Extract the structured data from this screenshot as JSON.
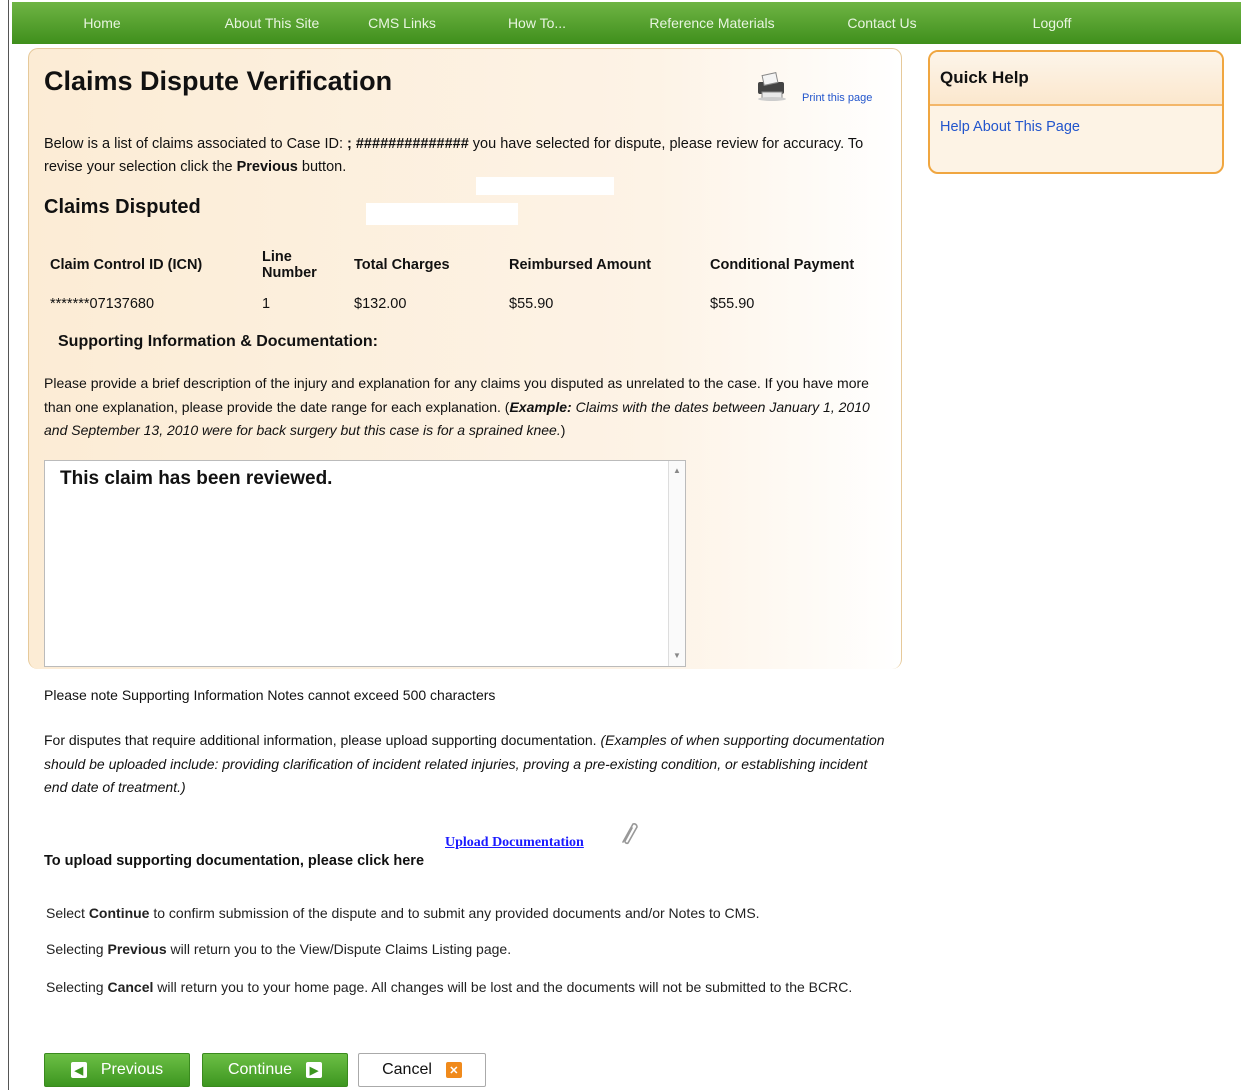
{
  "nav": [
    "Home",
    "About This Site",
    "CMS Links",
    "How To...",
    "Reference Materials",
    "Contact Us",
    "Logoff"
  ],
  "page": {
    "title": "Claims Dispute Verification",
    "print_label": "Print this page",
    "intro_before": "Below is a list of claims associated to Case ID: ",
    "case_id": "; ##############",
    "intro_after": "  you have selected for dispute, please review for accuracy. To revise your selection click the ",
    "intro_bold": "Previous",
    "intro_end": " button."
  },
  "claims": {
    "heading": "Claims Disputed",
    "columns": [
      "Claim Control ID (ICN)",
      "Line Number",
      "Total Charges",
      "Reimbursed Amount",
      "Conditional Payment"
    ],
    "rows": [
      [
        "*******07137680",
        "1",
        "$132.00",
        "$55.90",
        "$55.90"
      ]
    ]
  },
  "supporting": {
    "heading": "Supporting Information & Documentation:",
    "p1": "Please provide a brief description of the injury and explanation for any claims you disputed as unrelated to the case. If you have more than one explanation, please provide the date range for each explanation. (",
    "p1_example_label": "Example:",
    "p1_example": " Claims with the dates between January 1, 2010 and September 13, 2010 were for back surgery but this case is for a sprained knee.",
    "p1_end": ")",
    "textarea_value": "This claim has been reviewed.",
    "note": "Please note Supporting Information Notes cannot exceed 500 characters",
    "p2": "For disputes that require additional information, please upload supporting documentation. ",
    "p2_italic": "(Examples of when supporting documentation should be uploaded include: providing clarification of incident related injuries, proving a pre-existing condition, or establishing incident end date of treatment.)",
    "upload_link": "Upload Documentation ",
    "upload_label": "To upload supporting documentation, please click here"
  },
  "instructions": [
    {
      "before": "Select ",
      "bold": "Continue",
      "after": " to confirm submission of the dispute and to submit any provided documents and/or Notes to CMS."
    },
    {
      "before": "Selecting ",
      "bold": "Previous",
      "after": " will return you to the View/Dispute Claims Listing page."
    },
    {
      "before": "Selecting ",
      "bold": "Cancel",
      "after": " will return you to your home page. All changes will be lost and the documents will not be submitted to the BCRC."
    }
  ],
  "buttons": {
    "previous": "Previous",
    "continue": "Continue",
    "cancel": "Cancel"
  },
  "quick_help": {
    "title": "Quick Help",
    "link": "Help About This Page"
  }
}
